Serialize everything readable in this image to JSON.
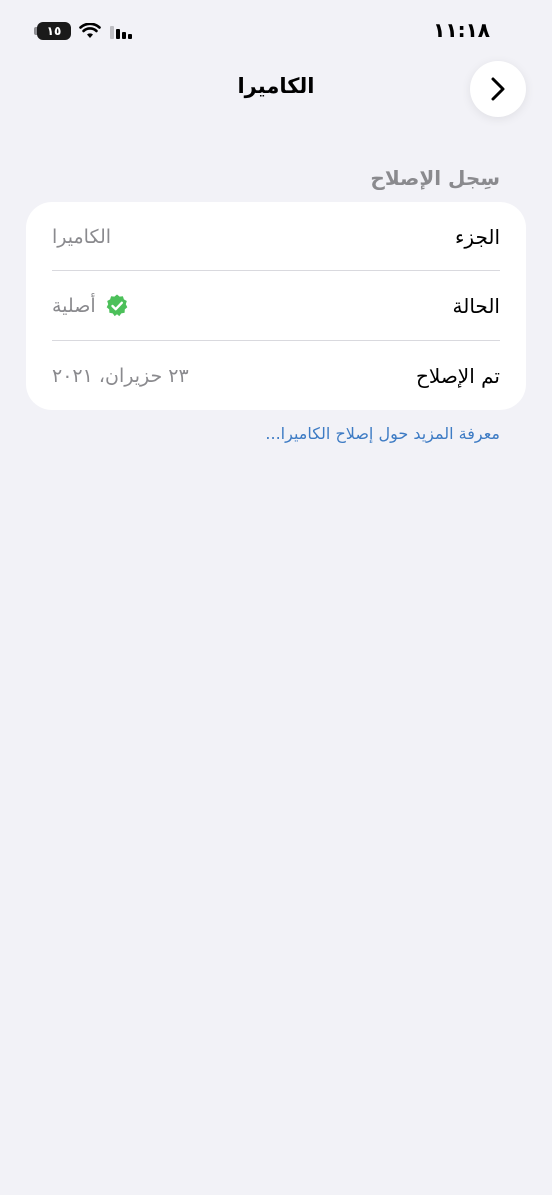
{
  "status_bar": {
    "time": "١١:١٨",
    "battery": "١٥",
    "icons": [
      "battery-icon",
      "wifi-icon",
      "signal-icon"
    ]
  },
  "nav": {
    "title": "الكاميرا",
    "back_icon": "chevron-right-icon"
  },
  "section": {
    "header": "سِجل الإصلاح"
  },
  "rows": [
    {
      "label": "الجزء",
      "value": "الكاميرا"
    },
    {
      "label": "الحالة",
      "value": "أصلية",
      "icon": "verified-check-icon"
    },
    {
      "label": "تم الإصلاح",
      "value": "٢٣ حزيران، ٢٠٢١"
    }
  ],
  "footer": {
    "link": "معرفة المزيد حول إصلاح الكاميرا..."
  },
  "colors": {
    "background": "#F2F2F7",
    "card": "#FFFFFF",
    "secondary_text": "#8A8A8E",
    "link": "#3D7BC4",
    "verified_green": "#4CC05A"
  }
}
